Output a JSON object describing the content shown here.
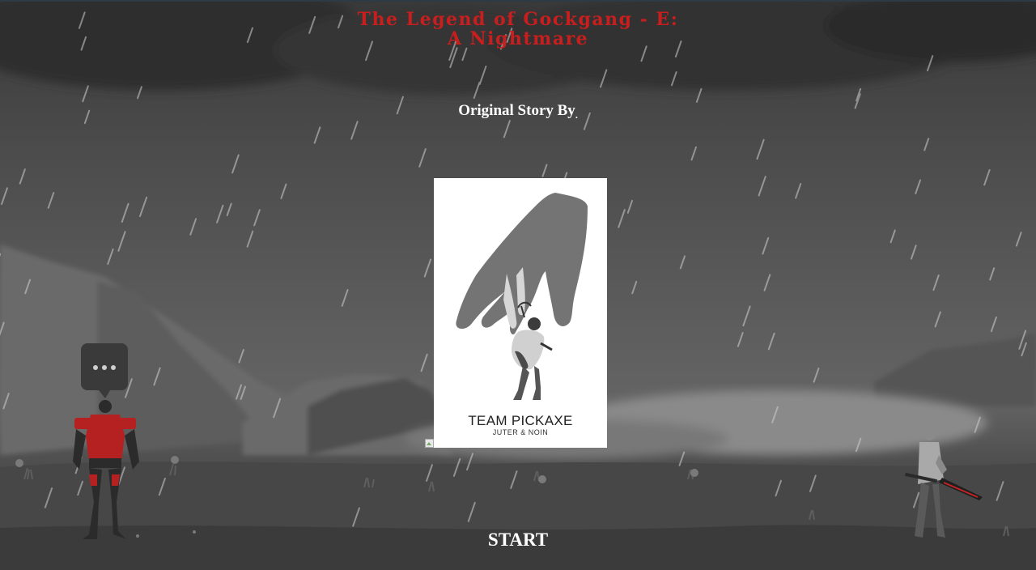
{
  "game": {
    "title_line1": "The Legend of Gockgang - E:",
    "title_line2": "A Nightmare",
    "credit_label": "Original Story By",
    "credit_suffix": ".",
    "start_label": "START"
  },
  "poster": {
    "team_name": "TEAM PICKAXE",
    "members": "JUTER & NOIN"
  },
  "colors": {
    "title": "#c81e1e",
    "text": "#ffffff",
    "armor": "#b52020"
  },
  "icons": {
    "speech": "speech-bubble-ellipsis-icon",
    "broken_image": "broken-image-icon"
  }
}
